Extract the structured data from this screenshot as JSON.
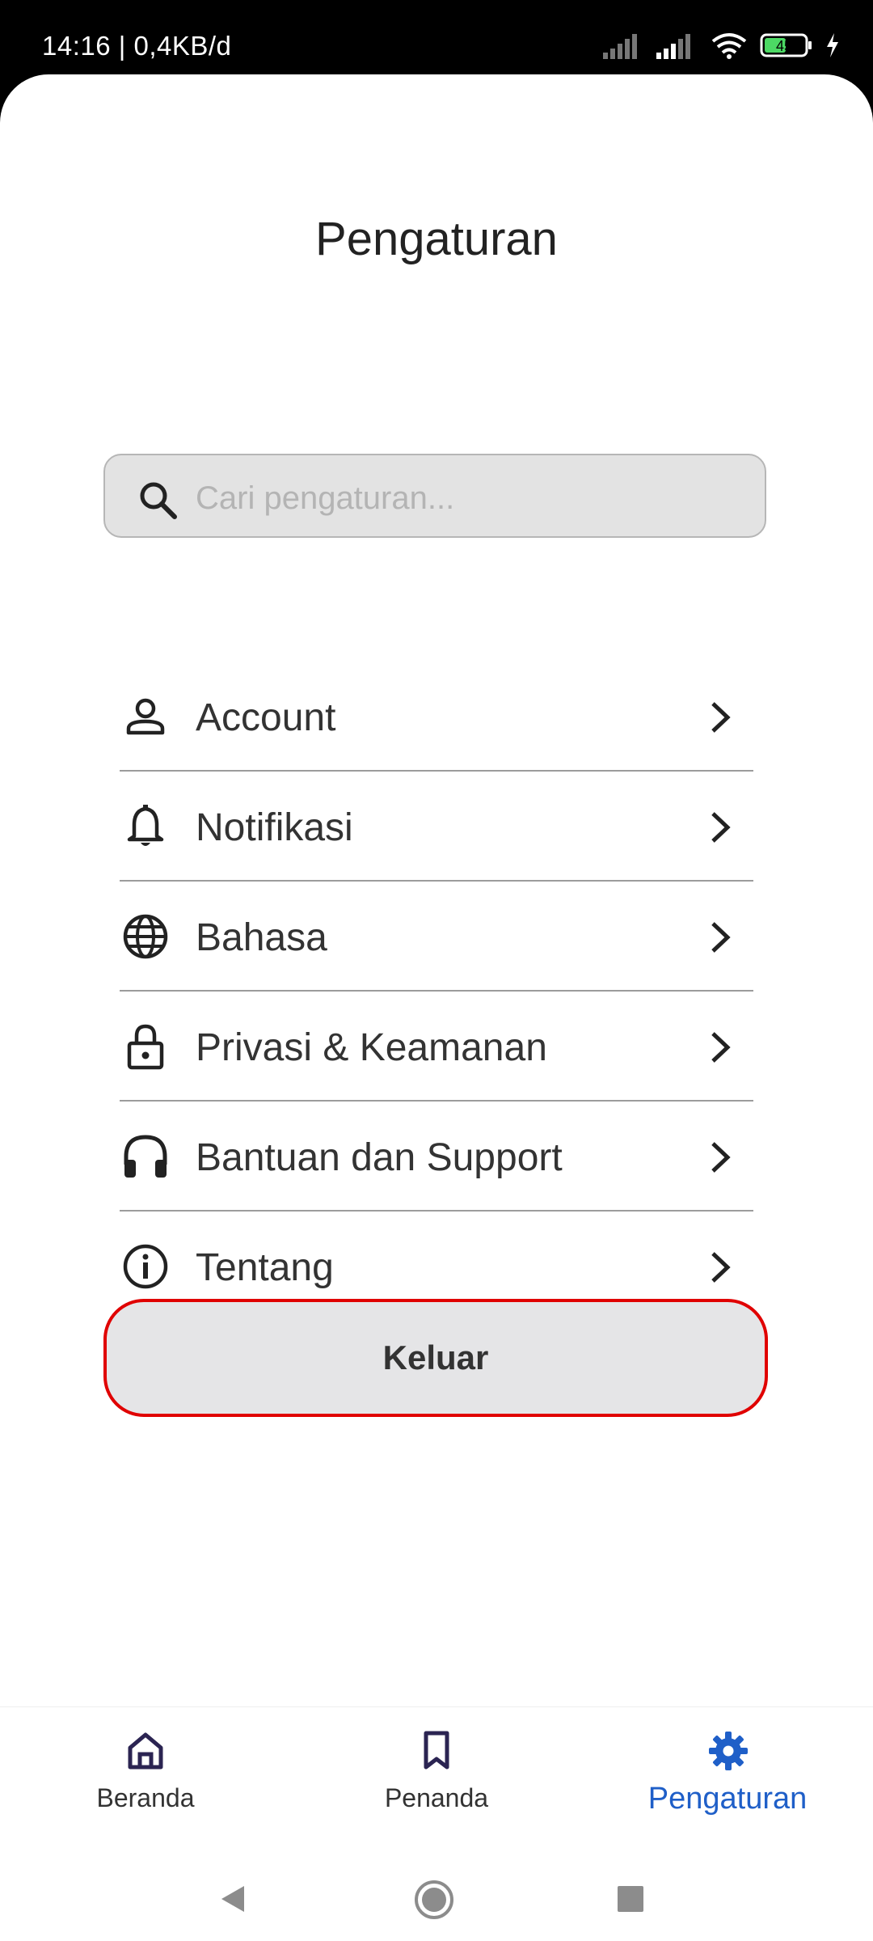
{
  "status_bar": {
    "time": "14:16 | 0,4KB/d",
    "battery": "45"
  },
  "page": {
    "title": "Pengaturan"
  },
  "search": {
    "placeholder": "Cari pengaturan..."
  },
  "menu": [
    {
      "label": "Account",
      "icon": "person-icon"
    },
    {
      "label": "Notifikasi",
      "icon": "bell-icon"
    },
    {
      "label": "Bahasa",
      "icon": "globe-icon"
    },
    {
      "label": "Privasi & Keamanan",
      "icon": "lock-icon"
    },
    {
      "label": "Bantuan dan Support",
      "icon": "headphones-icon"
    },
    {
      "label": "Tentang",
      "icon": "info-icon"
    }
  ],
  "logout": {
    "label": "Keluar",
    "border_color": "#e00000"
  },
  "bottom_nav": {
    "tabs": [
      {
        "label": "Beranda",
        "icon": "home-icon",
        "active": false
      },
      {
        "label": "Penanda",
        "icon": "bookmark-icon",
        "active": false
      },
      {
        "label": "Pengaturan",
        "icon": "gear-icon",
        "active": true
      }
    ],
    "active_color": "#1f5fc8"
  }
}
